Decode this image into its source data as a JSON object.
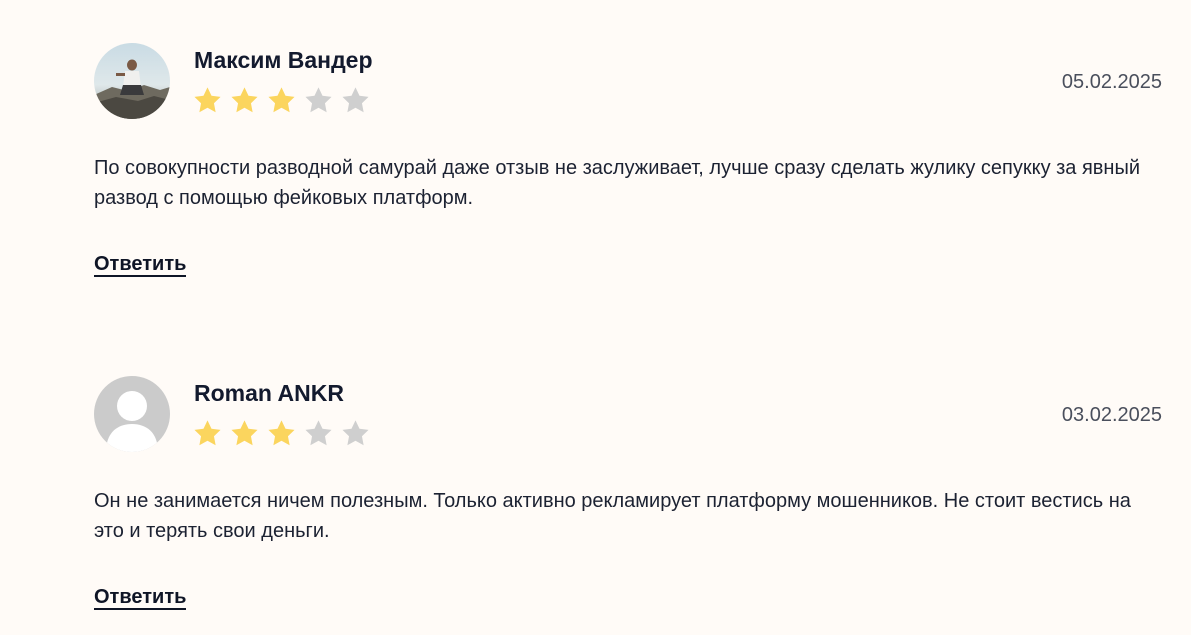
{
  "reviews": [
    {
      "author": "Максим Вандер",
      "date": "05.02.2025",
      "rating": 3,
      "max_rating": 5,
      "text": "По совокупности разводной самурай даже отзыв не заслуживает, лучше сразу сделать жулику сепукку за явный развод с помощью фейковых платформ.",
      "reply_label": "Ответить",
      "avatar": "photo-avatar"
    },
    {
      "author": "Roman ANKR",
      "date": "03.02.2025",
      "rating": 3,
      "max_rating": 5,
      "text": "Он не занимается ничем полезным. Только активно рекламирует платформу мошенников. Не стоит вестись на это и терять свои деньги.",
      "reply_label": "Ответить",
      "avatar": "default-user-avatar"
    }
  ],
  "colors": {
    "background": "#fffbf7",
    "star_filled": "#fbd55e",
    "star_empty": "#cfcfcf",
    "placeholder_avatar": "#cbcbcb"
  }
}
